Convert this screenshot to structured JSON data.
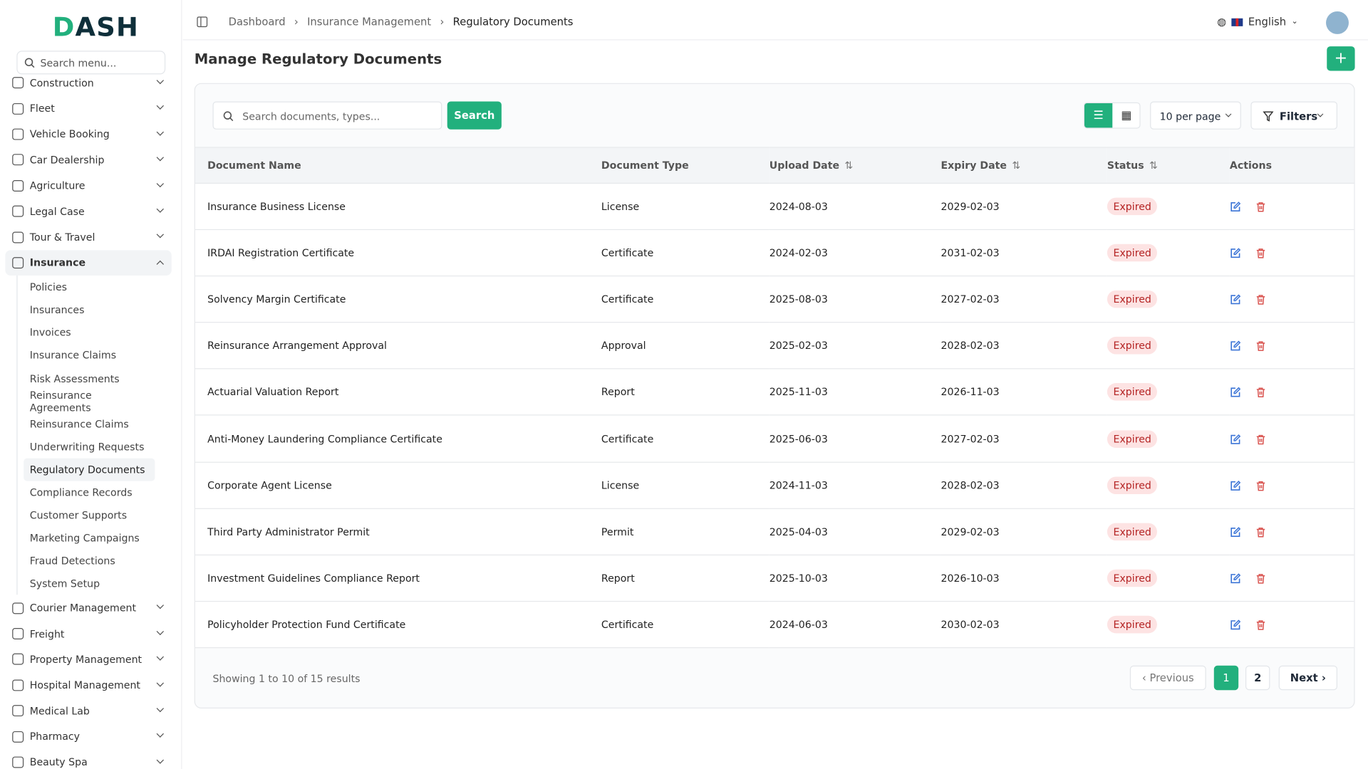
{
  "sidebar": {
    "logo": "DASH",
    "search_placeholder": "Search menu...",
    "items_before": [
      "Construction",
      "Fleet",
      "Vehicle Booking",
      "Car Dealership",
      "Agriculture",
      "Legal Case",
      "Tour & Travel"
    ],
    "open_item": "Insurance",
    "sub_items": [
      "Policies",
      "Insurances",
      "Invoices",
      "Insurance Claims",
      "Risk Assessments",
      "Reinsurance Agreements",
      "Reinsurance Claims",
      "Underwriting Requests",
      "Regulatory Documents",
      "Compliance Records",
      "Customer Supports",
      "Marketing Campaigns",
      "Fraud Detections",
      "System Setup"
    ],
    "active_sub": "Regulatory Documents",
    "items_after": [
      "Courier Management",
      "Freight",
      "Property Management",
      "Hospital Management",
      "Medical Lab",
      "Pharmacy",
      "Beauty Spa"
    ]
  },
  "header": {
    "breadcrumbs": [
      "Dashboard",
      "Insurance Management",
      "Regulatory Documents"
    ],
    "language": "English"
  },
  "page": {
    "title": "Manage Regulatory Documents",
    "add_label": "+"
  },
  "toolbar": {
    "search_placeholder": "Search documents, types...",
    "search_label": "Search",
    "per_page": "10 per page",
    "filters_label": "Filters"
  },
  "table": {
    "columns": [
      "Document Name",
      "Document Type",
      "Upload Date",
      "Expiry Date",
      "Status",
      "Actions"
    ],
    "rows": [
      [
        "Insurance Business License",
        "License",
        "2024-08-03",
        "2029-02-03",
        "Expired"
      ],
      [
        "IRDAI Registration Certificate",
        "Certificate",
        "2024-02-03",
        "2031-02-03",
        "Expired"
      ],
      [
        "Solvency Margin Certificate",
        "Certificate",
        "2025-08-03",
        "2027-02-03",
        "Expired"
      ],
      [
        "Reinsurance Arrangement Approval",
        "Approval",
        "2025-02-03",
        "2028-02-03",
        "Expired"
      ],
      [
        "Actuarial Valuation Report",
        "Report",
        "2025-11-03",
        "2026-11-03",
        "Expired"
      ],
      [
        "Anti-Money Laundering Compliance Certificate",
        "Certificate",
        "2025-06-03",
        "2027-02-03",
        "Expired"
      ],
      [
        "Corporate Agent License",
        "License",
        "2024-11-03",
        "2028-02-03",
        "Expired"
      ],
      [
        "Third Party Administrator Permit",
        "Permit",
        "2025-04-03",
        "2029-02-03",
        "Expired"
      ],
      [
        "Investment Guidelines Compliance Report",
        "Report",
        "2025-10-03",
        "2026-10-03",
        "Expired"
      ],
      [
        "Policyholder Protection Fund Certificate",
        "Certificate",
        "2024-06-03",
        "2030-02-03",
        "Expired"
      ]
    ]
  },
  "pagination": {
    "summary": "Showing 1 to 10 of 15 results",
    "previous": "Previous",
    "pages": [
      "1",
      "2"
    ],
    "next": "Next"
  },
  "colors": {
    "accent": "#22b07d",
    "danger": "#b42323",
    "edit": "#3b74d6"
  }
}
